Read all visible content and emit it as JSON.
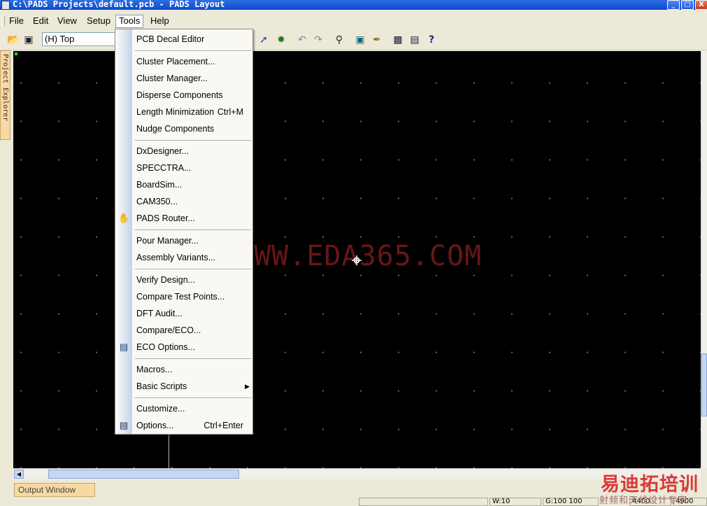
{
  "window": {
    "title": "C:\\PADS Projects\\default.pcb - PADS Layout",
    "buttons": {
      "minimize": "_",
      "maximize": "□",
      "close": "X"
    }
  },
  "menubar": {
    "items": [
      {
        "label": "File"
      },
      {
        "label": "Edit"
      },
      {
        "label": "View"
      },
      {
        "label": "Setup"
      },
      {
        "label": "Tools"
      },
      {
        "label": "Help"
      }
    ]
  },
  "toolbar": {
    "layer_select": "(H) Top",
    "icons": [
      "open-icon",
      "save-icon",
      "route-icon",
      "cluster-icon",
      "undo-icon",
      "redo-icon",
      "zoom-icon",
      "verify-icon",
      "clear-icon",
      "report-icon",
      "window-icon",
      "help-icon"
    ]
  },
  "tools_menu": {
    "groups": [
      [
        {
          "label": "PCB Decal Editor",
          "shortcut": ""
        }
      ],
      [
        {
          "label": "Cluster Placement...",
          "shortcut": ""
        },
        {
          "label": "Cluster Manager...",
          "shortcut": ""
        },
        {
          "label": "Disperse Components",
          "shortcut": ""
        },
        {
          "label": "Length Minimization",
          "shortcut": "Ctrl+M"
        },
        {
          "label": "Nudge Components",
          "shortcut": ""
        }
      ],
      [
        {
          "label": "DxDesigner...",
          "shortcut": ""
        },
        {
          "label": "SPECCTRA...",
          "shortcut": ""
        },
        {
          "label": "BoardSim...",
          "shortcut": ""
        },
        {
          "label": "CAM350...",
          "shortcut": ""
        },
        {
          "label": "PADS Router...",
          "shortcut": "",
          "icon": "router-icon"
        }
      ],
      [
        {
          "label": "Pour Manager...",
          "shortcut": ""
        },
        {
          "label": "Assembly Variants...",
          "shortcut": ""
        }
      ],
      [
        {
          "label": "Verify Design...",
          "shortcut": ""
        },
        {
          "label": "Compare Test Points...",
          "shortcut": ""
        },
        {
          "label": "DFT Audit...",
          "shortcut": ""
        },
        {
          "label": "Compare/ECO...",
          "shortcut": ""
        },
        {
          "label": "ECO Options...",
          "shortcut": "",
          "icon": "eco-options-icon"
        }
      ],
      [
        {
          "label": "Macros...",
          "shortcut": ""
        },
        {
          "label": "Basic Scripts",
          "shortcut": "",
          "submenu": true
        }
      ],
      [
        {
          "label": "Customize...",
          "shortcut": ""
        },
        {
          "label": "Options...",
          "shortcut": "Ctrl+Enter",
          "icon": "options-icon"
        }
      ]
    ]
  },
  "side_panel": {
    "project_explorer": "Project Explorer"
  },
  "canvas": {
    "watermark": "WWW.EDA365.COM",
    "background": "#000000"
  },
  "output_window": {
    "label": "Output Window"
  },
  "status": {
    "w": "W:10",
    "g": "G:100 100",
    "x": "4400",
    "y": "4900"
  },
  "logo": {
    "title": "易迪拓培训",
    "subtitle": "射频和天线设计专家"
  }
}
